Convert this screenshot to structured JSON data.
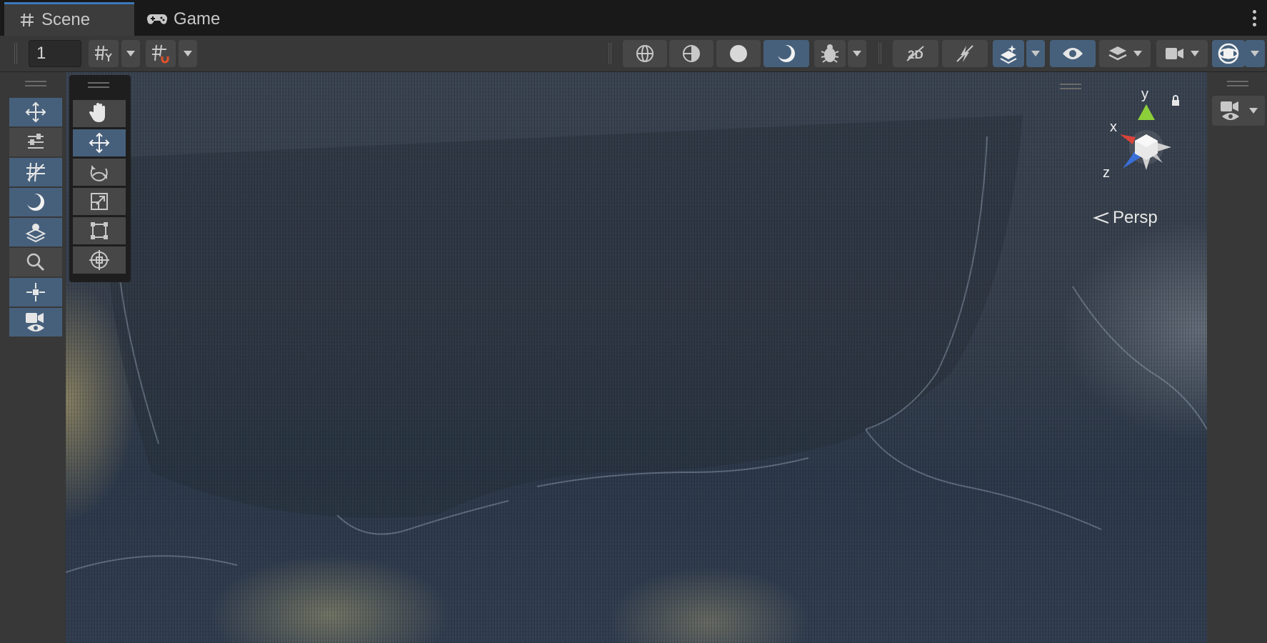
{
  "tabs": [
    {
      "label": "Scene",
      "icon": "grid-hash-icon",
      "active": true
    },
    {
      "label": "Game",
      "icon": "gamepad-icon",
      "active": false
    }
  ],
  "toolbar": {
    "snap_increment_value": "1",
    "buttons": [
      "grid-visibility-icon",
      "grid-snap-icon",
      "wireframe-shading-icon",
      "shaded-wireframe-icon",
      "shaded-icon",
      "lit-shading-icon",
      "debug-draw-mode-icon",
      "toggle-2d-icon",
      "lighting-toggle-icon",
      "effects-icon",
      "scene-visibility-icon",
      "layers-icon",
      "camera-settings-icon",
      "gizmos-icon"
    ]
  },
  "left_tools": [
    "move-icon",
    "transform-options-icon",
    "grid-snap-icon",
    "shading-icon",
    "layers-stack-icon",
    "search-icon",
    "pivot-icon",
    "camera-preview-icon"
  ],
  "manipulation_tools": [
    {
      "name": "hand-tool",
      "active": false
    },
    {
      "name": "move-tool",
      "active": true
    },
    {
      "name": "rotate-tool",
      "active": false
    },
    {
      "name": "scale-tool",
      "active": false
    },
    {
      "name": "rect-tool",
      "active": false
    },
    {
      "name": "transform-tool",
      "active": false
    }
  ],
  "orientation_gizmo": {
    "x_label": "x",
    "y_label": "y",
    "z_label": "z"
  },
  "projection_label": "Persp",
  "colors": {
    "accent": "#46607c",
    "tab_indicator": "#3a79bb",
    "axis_x": "#d9443a",
    "axis_y": "#8ccf3a",
    "axis_z": "#3a6fd9"
  }
}
